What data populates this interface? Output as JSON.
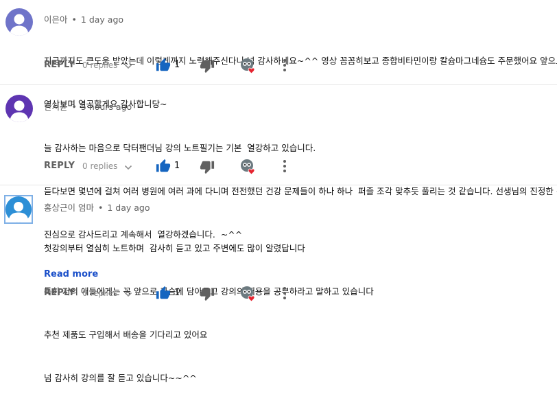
{
  "accent_color": "#1a4fc9",
  "like_color": "#1565c0",
  "icons": {
    "like": "thumbs-up-icon",
    "dislike": "thumbs-down-icon",
    "expand": "chevron-down-icon",
    "creator_heart": "creator-heart-icon",
    "more": "more-vert-icon"
  },
  "comments": [
    {
      "author": "이은아",
      "dot": "•",
      "time": "1 day ago",
      "lines": [
        "지금까지도 큰도움 받았는데 이렇게까지 노력해주신다니 넘 감사하네요~^^ 영상 꼼꼼히보고 종합비타민이랑 칼슘마그네슘도 주문했어요 앞으로도",
        "영상보며 열공할게요 감사합니당~"
      ],
      "reply_label": "REPLY",
      "replies_label": "0 replies",
      "likes": "1"
    },
    {
      "author": "한서윤",
      "dot": "•",
      "time": "5 hours ago",
      "lines": [
        "늘 감사하는 마음으로 닥터팬더님 강의 노트필기는 기본  열강하고 있습니다.",
        "듣다보면 몇년에 걸쳐 여러 병원에 여러 과에 다니며 전전했던 건강 문제들이 하나 하나  퍼즐 조각 맞추듯 풀리는 것 같습니다. 선생님의 진정한 선의",
        "진심으로 감사드리고 계속해서  열강하겠습니다.  ~^^"
      ],
      "reply_label": "REPLY",
      "replies_label": "0 replies",
      "likes": "1"
    },
    {
      "author": "홍상근이 엄마",
      "dot": "•",
      "time": "1 day ago",
      "lines": [
        "첫강의부터 열심히 노트하며  감사히 듣고 있고 주변에도 많이 알렸답니다",
        "특히 저의 애들에게는 꼭 앞으로 가슴에 담아두고 강의의 내용을 공부하라고 말하고 있습니다",
        "추천 제품도 구입해서 배송을 기다리고 있어요",
        "넘 감사히 강의를 잘 듣고 있습니다~~^^"
      ],
      "read_more": "Read more",
      "reply_label": "REPLY",
      "replies_label": "0 replies",
      "likes": "1"
    }
  ]
}
